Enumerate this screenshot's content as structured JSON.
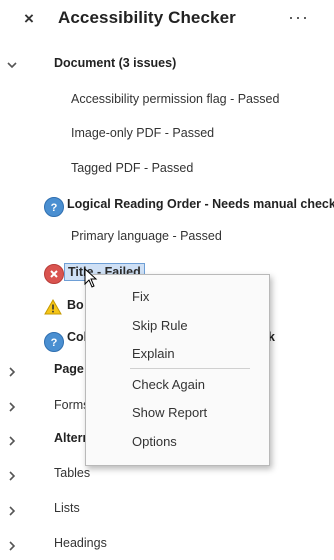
{
  "header": {
    "title": "Accessibility Checker",
    "close_glyph": "×",
    "more_glyph": "···"
  },
  "document": {
    "label": "Document (3 issues)",
    "items": [
      "Accessibility permission flag - Passed",
      "Image-only PDF - Passed",
      "Tagged PDF - Passed",
      "Logical Reading Order - Needs manual check",
      "Primary language - Passed",
      "Title - Failed",
      "Bo",
      "Col",
      "k"
    ]
  },
  "sections": [
    "Page",
    "Forms",
    "Altern",
    "Tables",
    "Lists",
    "Headings"
  ],
  "context_menu": {
    "items": [
      "Fix",
      "Skip Rule",
      "Explain",
      "Check Again",
      "Show Report",
      "Options"
    ]
  },
  "colors": {
    "info": "#4a8fd1",
    "fail": "#d9534f",
    "warning": "#f5c518",
    "selection": "#cfe0f5"
  }
}
